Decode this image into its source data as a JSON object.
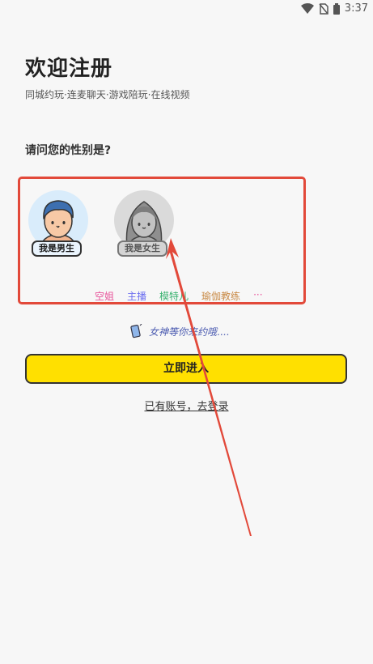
{
  "status_bar": {
    "time": "3:37"
  },
  "header": {
    "title": "欢迎注册",
    "subtitle": "同城约玩·连麦聊天·游戏陪玩·在线视频"
  },
  "question": "请问您的性别是?",
  "gender_options": {
    "male": {
      "label": "我是男生"
    },
    "female": {
      "label": "我是女生"
    }
  },
  "tags": [
    {
      "label": "空姐",
      "color": "#e8549b"
    },
    {
      "label": "主播",
      "color": "#6c6ff0"
    },
    {
      "label": "模特儿",
      "color": "#3cb371"
    },
    {
      "label": "瑜伽教练",
      "color": "#c98a46"
    },
    {
      "label": "···",
      "color": "#e8549b"
    }
  ],
  "hint": "女神等你来约哦....",
  "primary_button": "立即进入",
  "login_link": "已有账号，去登录",
  "annotation_color": "#e2493a"
}
